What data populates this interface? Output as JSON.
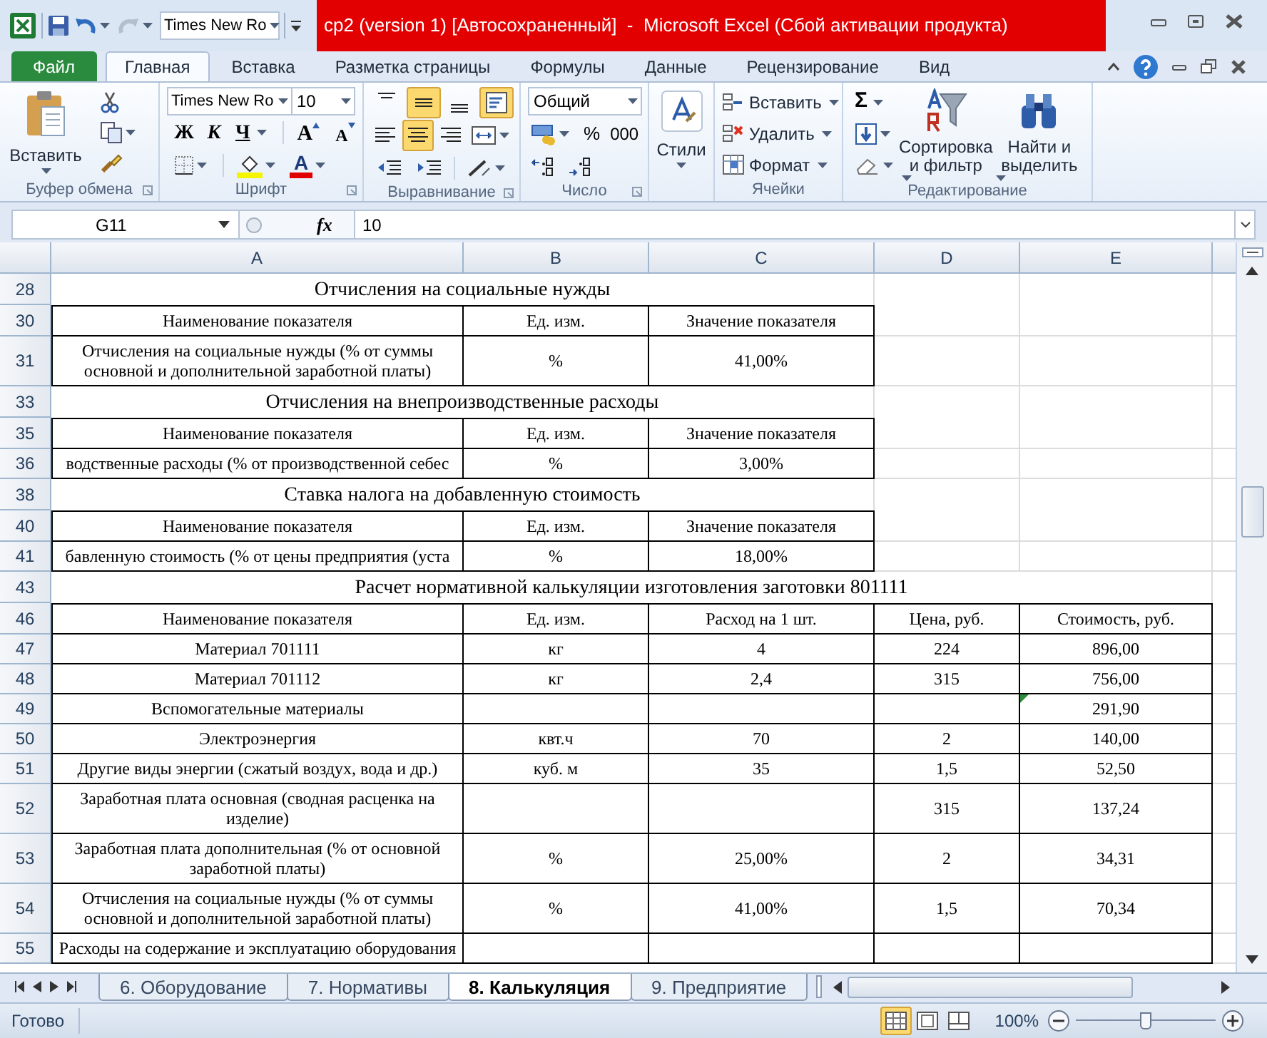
{
  "quick_access": {
    "font": "Times New Ro"
  },
  "window": {
    "title": "cp2 (version 1) [Автосохраненный]  -  Microsoft Excel (Сбой активации продукта)"
  },
  "menu_tabs": [
    {
      "label": "Файл",
      "kind": "file",
      "selected": false
    },
    {
      "label": "Главная",
      "kind": "tab",
      "selected": true
    },
    {
      "label": "Вставка",
      "kind": "tab",
      "selected": false
    },
    {
      "label": "Разметка страницы",
      "kind": "tab",
      "selected": false
    },
    {
      "label": "Формулы",
      "kind": "tab",
      "selected": false
    },
    {
      "label": "Данные",
      "kind": "tab",
      "selected": false
    },
    {
      "label": "Рецензирование",
      "kind": "tab",
      "selected": false
    },
    {
      "label": "Вид",
      "kind": "tab",
      "selected": false
    }
  ],
  "ribbon": {
    "clipboard": {
      "label": "Буфер обмена",
      "paste": "Вставить"
    },
    "font": {
      "label": "Шрифт",
      "font_name": "Times New Ro",
      "font_size": "10",
      "bold": "Ж",
      "italic": "К",
      "underline": "Ч",
      "grow": "A",
      "shrink": "A",
      "font_color": "A"
    },
    "alignment": {
      "label": "Выравнивание",
      "buttons": [
        {
          "kind": "top",
          "pressed": false
        },
        {
          "kind": "middle",
          "pressed": true
        },
        {
          "kind": "bottom",
          "pressed": false
        },
        {
          "kind": "wrap",
          "pressed": true
        },
        {
          "kind": "left",
          "pressed": false
        },
        {
          "kind": "center",
          "pressed": true
        },
        {
          "kind": "right",
          "pressed": false
        },
        {
          "kind": "merge",
          "pressed": false
        }
      ]
    },
    "number": {
      "label": "Число",
      "format": "Общий",
      "percent": "%",
      "thousands": "000"
    },
    "styles": {
      "label": "Стили"
    },
    "cells": {
      "label": "Ячейки",
      "items": [
        {
          "kind": "insert",
          "label": "Вставить"
        },
        {
          "kind": "delete",
          "label": "Удалить"
        },
        {
          "kind": "format",
          "label": "Формат"
        }
      ]
    },
    "editing": {
      "label": "Редактирование",
      "sum": "Σ",
      "sort": "Сортировка и фильтр",
      "find": "Найти и выделить"
    }
  },
  "formula_bar": {
    "name_box": "G11",
    "fx": "fx",
    "value": "10"
  },
  "columns": [
    "A",
    "B",
    "C",
    "D",
    "E"
  ],
  "sections": [
    {
      "title_row": "28",
      "title": "Отчисления на социальные нужды",
      "header": {
        "row": "30",
        "cells": [
          "Наименование показателя",
          "Ед. изм.",
          "Значение показателя"
        ]
      },
      "rows": [
        {
          "row": "31",
          "cells": [
            "Отчисления на социальные нужды (% от суммы основной и дополнительной заработной платы)",
            "%",
            "41,00%"
          ]
        }
      ]
    },
    {
      "title_row": "33",
      "title": "Отчисления на внепроизводственные расходы",
      "header": {
        "row": "35",
        "cells": [
          "Наименование показателя",
          "Ед. изм.",
          "Значение показателя"
        ]
      },
      "rows": [
        {
          "row": "36",
          "cells": [
            "водственные расходы (% от производственной себес",
            "%",
            "3,00%"
          ]
        }
      ]
    },
    {
      "title_row": "38",
      "title": "Ставка налога на добавленную стоимость",
      "header": {
        "row": "40",
        "cells": [
          "Наименование показателя",
          "Ед. изм.",
          "Значение показателя"
        ]
      },
      "rows": [
        {
          "row": "41",
          "cells": [
            "бавленную стоимость (% от цены предприятия (уста",
            "%",
            "18,00%"
          ]
        }
      ]
    },
    {
      "title_row": "43",
      "title": "Расчет нормативной калькуляции изготовления заготовки 801111",
      "header": {
        "row": "46",
        "cells": [
          "Наименование показателя",
          "Ед. изм.",
          "Расход на 1 шт.",
          "Цена, руб.",
          "Стоимость, руб."
        ]
      },
      "rows": [
        {
          "row": "47",
          "cells": [
            "Материал 701111",
            "кг",
            "4",
            "224",
            "896,00"
          ]
        },
        {
          "row": "48",
          "cells": [
            "Материал 701112",
            "кг",
            "2,4",
            "315",
            "756,00"
          ]
        },
        {
          "row": "49",
          "cells": [
            "Вспомогательные материалы",
            null,
            null,
            null,
            {
              "text": "291,90",
              "flagged": true
            }
          ]
        },
        {
          "row": "50",
          "cells": [
            "Электроэнергия",
            "квт.ч",
            "70",
            "2",
            "140,00"
          ]
        },
        {
          "row": "51",
          "cells": [
            "Другие виды энергии (сжатый воздух, вода и др.)",
            "куб. м",
            "35",
            "1,5",
            "52,50"
          ]
        },
        {
          "row": "52",
          "cells": [
            "Заработная плата основная (сводная расценка на изделие)",
            null,
            null,
            "315",
            "137,24"
          ]
        },
        {
          "row": "53",
          "cells": [
            "Заработная плата дополнительная (% от основной заработной платы)",
            "%",
            "25,00%",
            "2",
            "34,31"
          ]
        },
        {
          "row": "54",
          "cells": [
            "Отчисления на социальные нужды (% от суммы основной и дополнительной заработной платы)",
            "%",
            "41,00%",
            "1,5",
            "70,34"
          ]
        },
        {
          "row": "55",
          "cells": [
            "Расходы на содержание и эксплуатацию оборудования",
            null,
            null,
            null,
            null
          ]
        }
      ]
    }
  ],
  "sheet_tabs": [
    {
      "label": "6. Оборудование",
      "selected": false
    },
    {
      "label": "7. Нормативы",
      "selected": false
    },
    {
      "label": "8. Калькуляция",
      "selected": true
    },
    {
      "label": "9. Предприятие",
      "selected": false
    }
  ],
  "status_bar": {
    "text": "Готово",
    "views": [
      {
        "kind": "normal",
        "selected": true
      },
      {
        "kind": "page_layout",
        "selected": false
      },
      {
        "kind": "page_break",
        "selected": false
      }
    ],
    "zoom": "100%",
    "zoom_slider": {
      "level": 0.5
    }
  }
}
